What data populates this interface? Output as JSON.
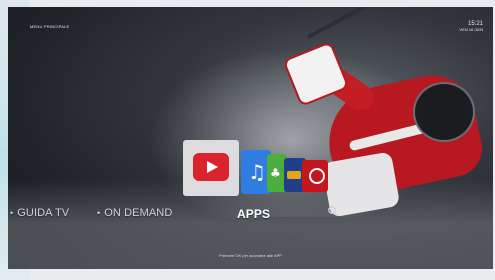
{
  "status_bar": {
    "channel_label": "MENU PRINCIPALE",
    "time": "15:21",
    "date": "VEN 16 GEN"
  },
  "apps": [
    {
      "name": "youtube-icon"
    },
    {
      "name": "music-icon"
    },
    {
      "name": "green-app-icon"
    },
    {
      "name": "orange-app-icon"
    },
    {
      "name": "pinterest-icon"
    }
  ],
  "menu": {
    "items": [
      {
        "label": "GUIDA TV"
      },
      {
        "label": "ON DEMAND"
      },
      {
        "label": "APPS"
      }
    ],
    "bullet": "•",
    "search_icon": "search-icon"
  },
  "hint_text": "Premere OK per accedere alle APP",
  "colors": {
    "youtube_red": "#d9232d",
    "selected_text": "#ffffff",
    "menu_text": "#cfd3d8"
  }
}
